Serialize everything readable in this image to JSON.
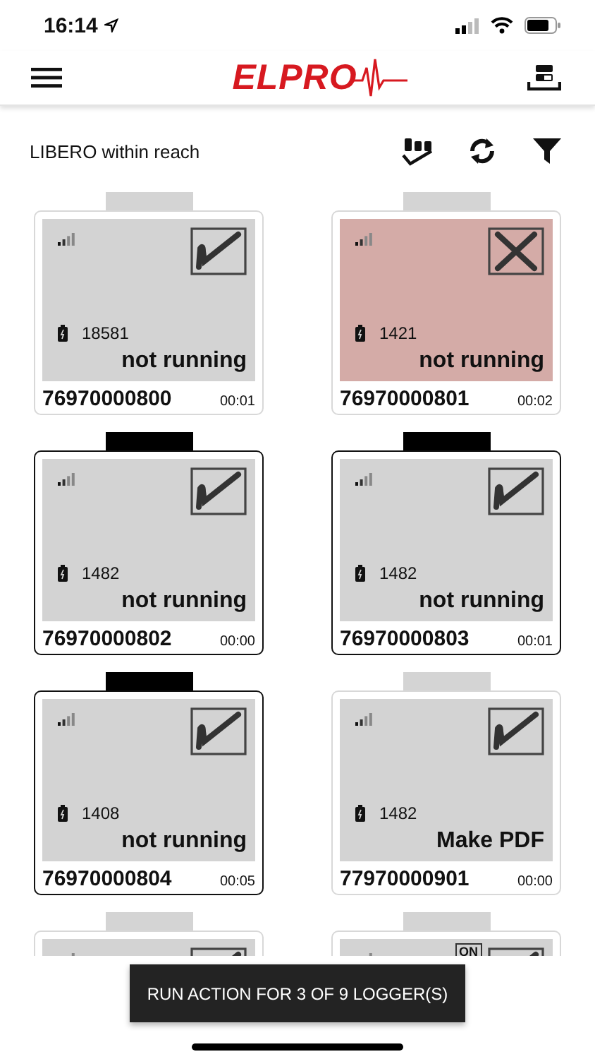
{
  "status_bar": {
    "time": "16:14"
  },
  "nav": {
    "logo": "ELPRO"
  },
  "header": {
    "title": "LIBERO within reach"
  },
  "loggers": [
    {
      "selected": false,
      "alarm": false,
      "battery": "18581",
      "status": "not running",
      "id": "76970000800",
      "time": "00:01"
    },
    {
      "selected": false,
      "alarm": true,
      "battery": "1421",
      "status": "not running",
      "id": "76970000801",
      "time": "00:02"
    },
    {
      "selected": true,
      "alarm": false,
      "battery": "1482",
      "status": "not running",
      "id": "76970000802",
      "time": "00:00"
    },
    {
      "selected": true,
      "alarm": false,
      "battery": "1482",
      "status": "not running",
      "id": "76970000803",
      "time": "00:01"
    },
    {
      "selected": true,
      "alarm": false,
      "battery": "1408",
      "status": "not running",
      "id": "76970000804",
      "time": "00:05"
    },
    {
      "selected": false,
      "alarm": false,
      "battery": "1482",
      "status": "Make PDF",
      "id": "77970000901",
      "time": "00:00"
    },
    {
      "selected": false,
      "alarm": false
    },
    {
      "selected": false,
      "alarm": false,
      "badge": "ON"
    }
  ],
  "action_button": {
    "label": "RUN ACTION FOR 3 OF 9 LOGGER(S)"
  }
}
